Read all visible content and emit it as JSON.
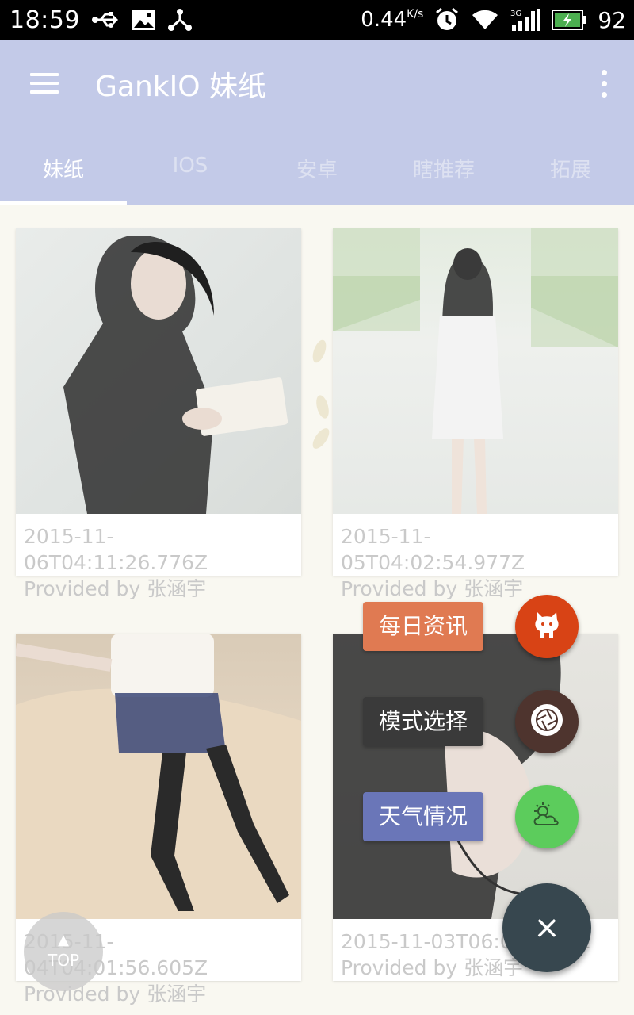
{
  "status_bar": {
    "time": "18:59",
    "net_speed": "0.44",
    "net_speed_unit": "K/s",
    "battery": "92",
    "icons": [
      "usb-icon",
      "image-icon",
      "share-icon",
      "alarm-icon",
      "wifi-icon",
      "signal-3g-icon",
      "battery-charging-icon"
    ]
  },
  "app_bar": {
    "title": "GankIO 妹纸",
    "menu_icon": "hamburger-menu-icon",
    "overflow_icon": "more-vert-icon",
    "color": "#c3cae8"
  },
  "tabs": [
    {
      "label": "妹纸",
      "active": true
    },
    {
      "label": "IOS",
      "active": false
    },
    {
      "label": "安卓",
      "active": false
    },
    {
      "label": "瞎推荐",
      "active": false
    },
    {
      "label": "拓展",
      "active": false
    }
  ],
  "cards": [
    {
      "caption": "2015-11-06T04:11:26.776Z Provided by 张涵宇"
    },
    {
      "caption": "2015-11-05T04:02:54.977Z Provided by 张涵宇"
    },
    {
      "caption": "2015-11-04T04:01:56.605Z Provided by 张涵宇"
    },
    {
      "caption": "2015-11-03T06:0… 399Z Provided by 张涵宇"
    }
  ],
  "fab_menu": {
    "items": [
      {
        "label": "每日资讯",
        "label_color": "#e07a52",
        "button_color": "#d84315",
        "icon": "github-octocat-icon"
      },
      {
        "label": "模式选择",
        "label_color": "#3a3a3a",
        "button_color": "#4e342e",
        "icon": "aperture-icon"
      },
      {
        "label": "天气情况",
        "label_color": "#6a76b8",
        "button_color": "#5ccc5c",
        "icon": "weather-icon"
      }
    ],
    "main_icon": "close-icon",
    "main_symbol": "×",
    "main_color": "#37474f"
  },
  "top_button": {
    "label": "TOP",
    "arrow": "▲"
  }
}
